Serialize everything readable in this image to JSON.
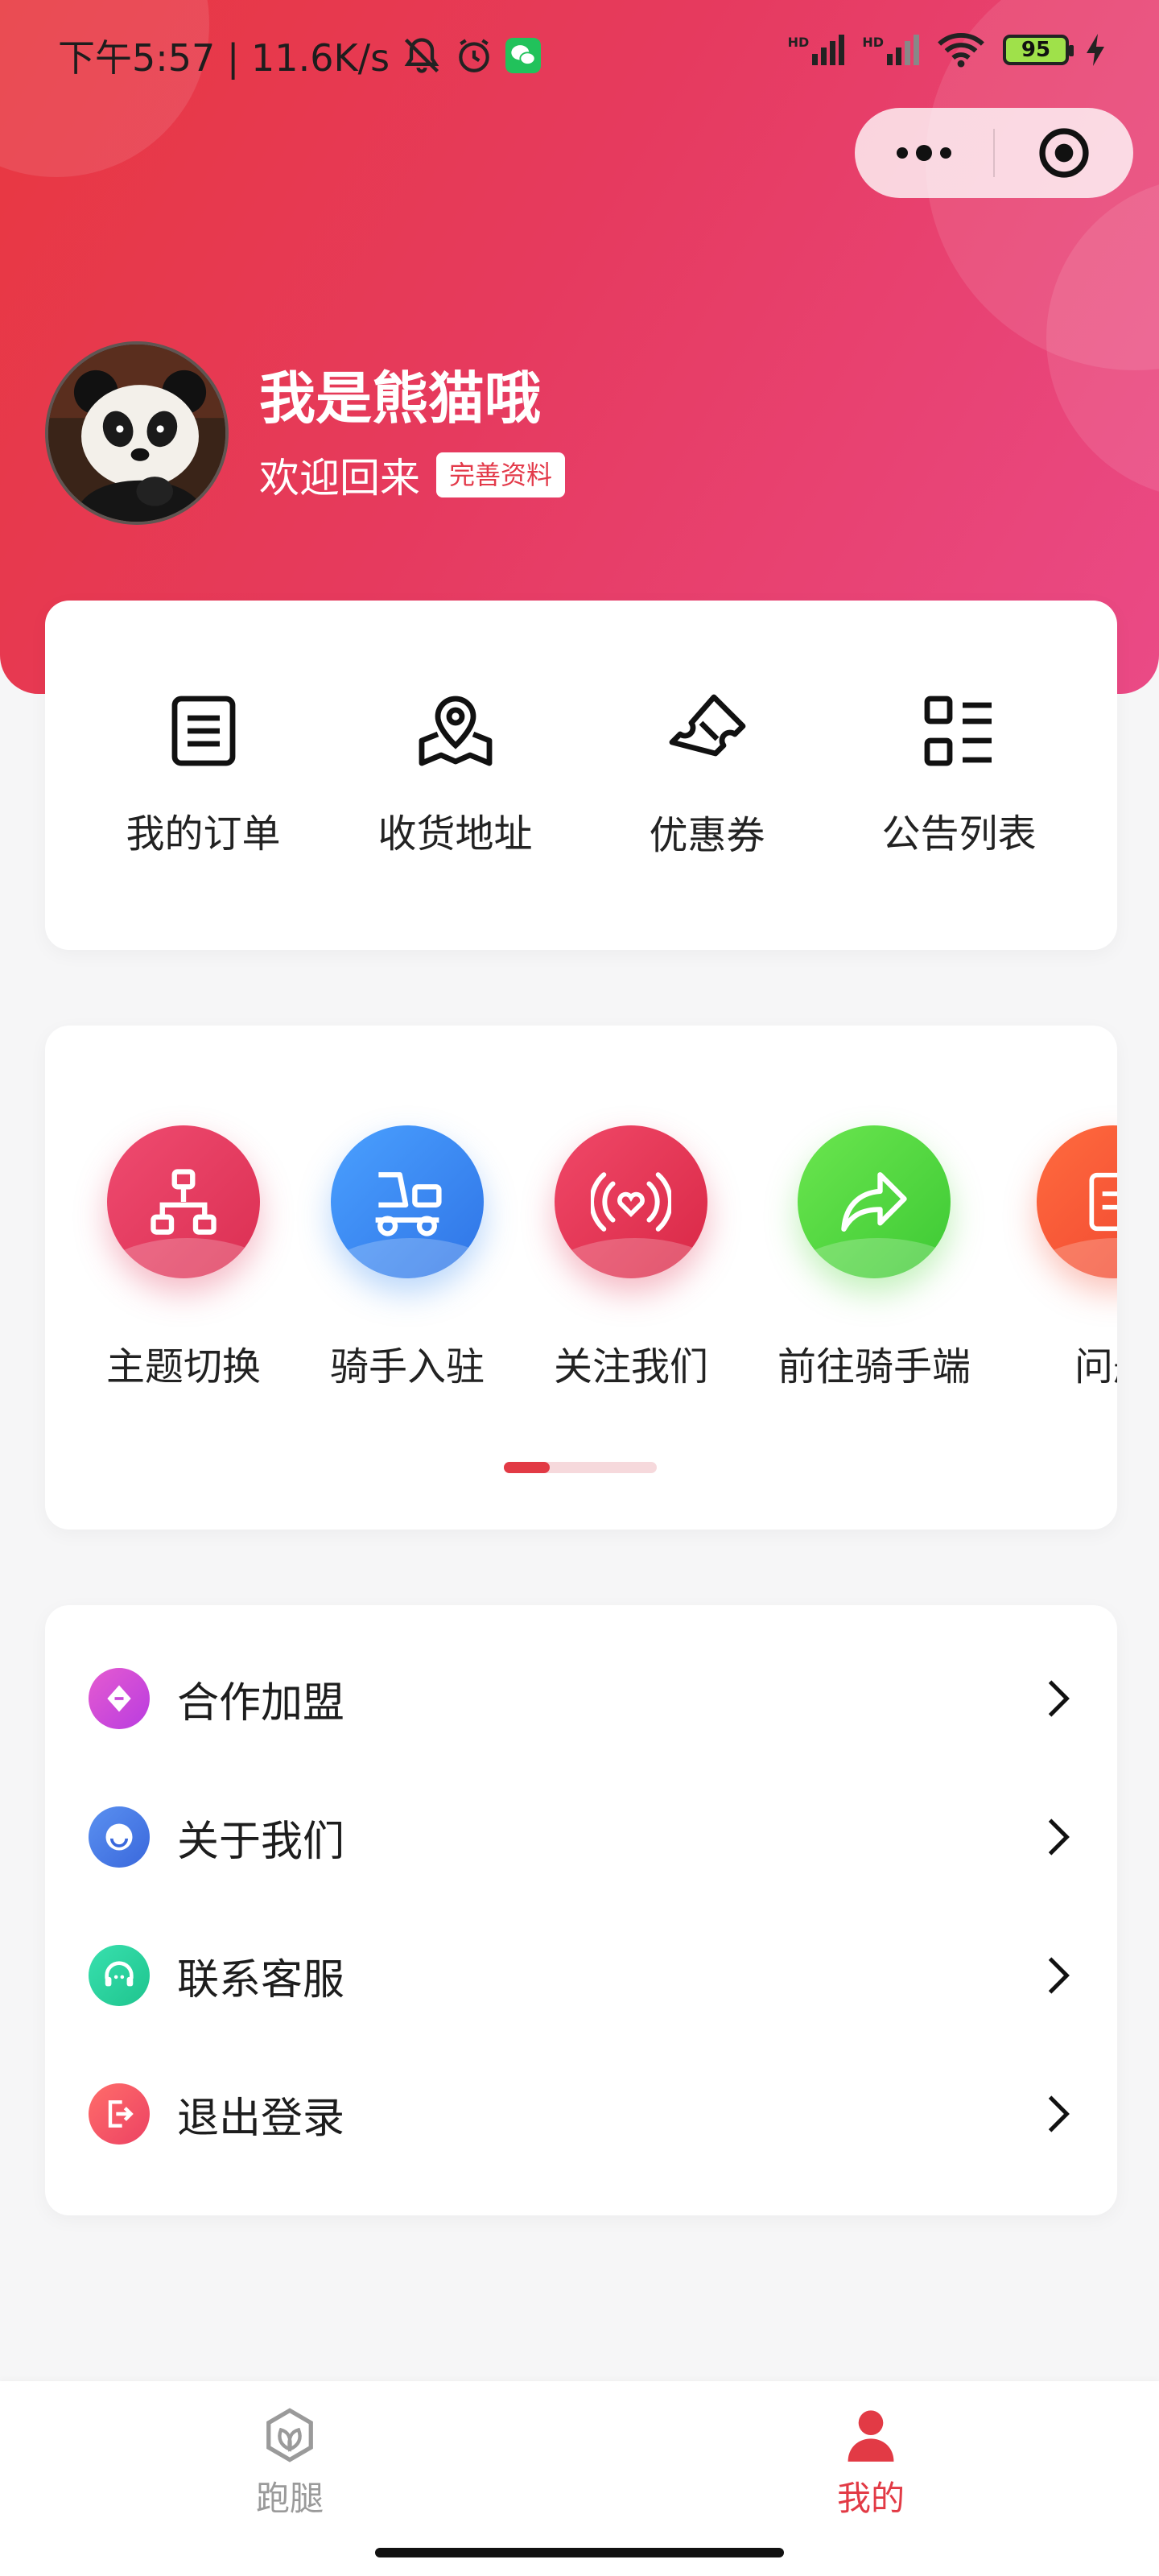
{
  "status_bar": {
    "time_speed": "下午5:57 | 11.6K/s",
    "battery": "95",
    "hd1": "HD",
    "hd2": "HD"
  },
  "profile": {
    "username": "我是熊猫哦",
    "welcome": "欢迎回来",
    "complete_profile": "完善资料"
  },
  "quick_actions": [
    {
      "label": "我的订单",
      "icon": "order-list-icon"
    },
    {
      "label": "收货地址",
      "icon": "map-pin-icon"
    },
    {
      "label": "优惠券",
      "icon": "ticket-icon"
    },
    {
      "label": "公告列表",
      "icon": "grid-list-icon"
    }
  ],
  "tools": [
    {
      "label": "主题切换",
      "icon": "hierarchy-icon",
      "color": "#e23c5e"
    },
    {
      "label": "骑手入驻",
      "icon": "scooter-icon",
      "color": "#3a8cf2"
    },
    {
      "label": "关注我们",
      "icon": "broadcast-heart-icon",
      "color": "#e23a58"
    },
    {
      "label": "前往骑手端",
      "icon": "share-arrow-icon",
      "color": "#52d640"
    },
    {
      "label": "问题",
      "icon": "document-icon",
      "color": "#f3573e"
    }
  ],
  "tools_scroll_progress": 0.3,
  "menu": [
    {
      "label": "合作加盟",
      "icon": "diamond-icon",
      "color": "#d34cd8"
    },
    {
      "label": "关于我们",
      "icon": "smile-icon",
      "color": "#4a7fe8"
    },
    {
      "label": "联系客服",
      "icon": "headset-icon",
      "color": "#2fd3a0"
    },
    {
      "label": "退出登录",
      "icon": "logout-icon",
      "color": "#f2545f"
    }
  ],
  "tabbar": [
    {
      "label": "跑腿",
      "icon": "leaf-hexagon-icon",
      "active": false
    },
    {
      "label": "我的",
      "icon": "person-icon",
      "active": true
    }
  ],
  "colors": {
    "accent": "#e23a45",
    "header_start": "#e8383f",
    "header_end": "#ea4a86",
    "tab_inactive": "#9a9a9a"
  }
}
